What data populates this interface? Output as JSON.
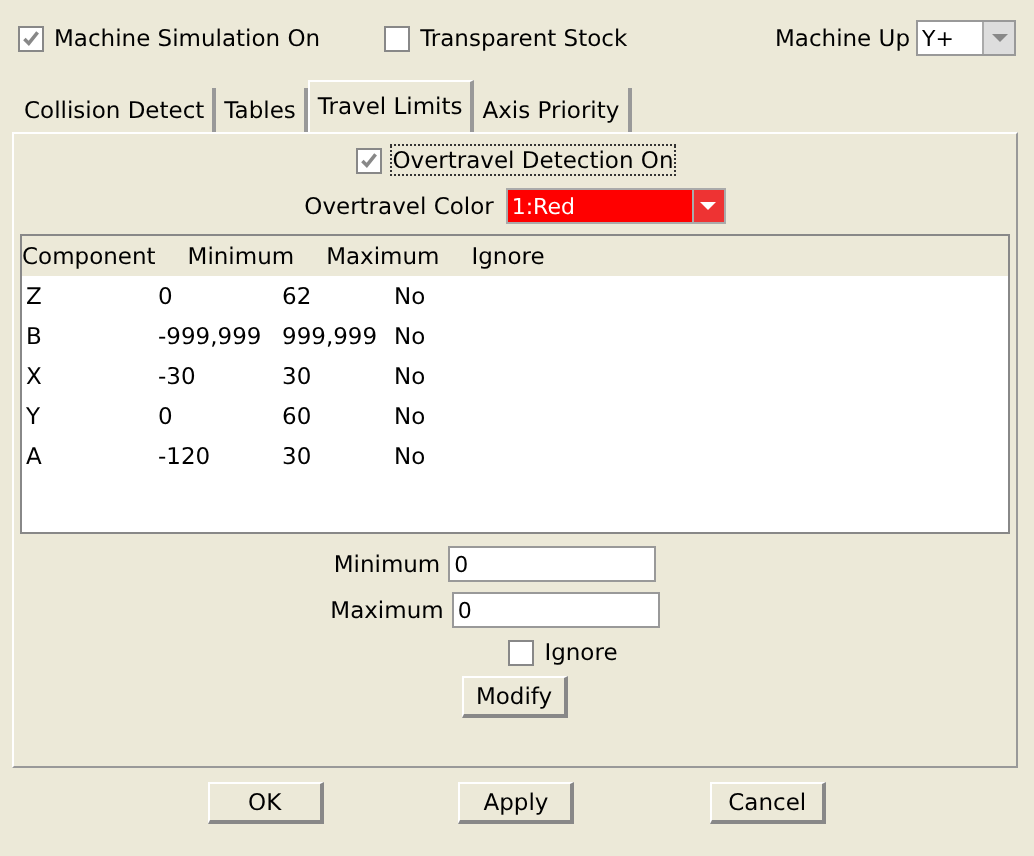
{
  "top_bar": {
    "machine_simulation": {
      "label": "Machine Simulation On",
      "checked": true
    },
    "transparent_stock": {
      "label": "Transparent Stock",
      "checked": false
    },
    "machine_up": {
      "label": "Machine Up",
      "value": "Y+"
    }
  },
  "tabs": [
    {
      "label": "Collision Detect",
      "selected": false
    },
    {
      "label": "Tables",
      "selected": false
    },
    {
      "label": "Travel Limits",
      "selected": true
    },
    {
      "label": "Axis Priority",
      "selected": false
    }
  ],
  "overtravel_detection": {
    "label": "Overtravel Detection On",
    "checked": true
  },
  "overtravel_color": {
    "label": "Overtravel Color",
    "value": "1:Red",
    "color": "#ff0000"
  },
  "table": {
    "columns": [
      "Component",
      "Minimum",
      "Maximum",
      "Ignore"
    ],
    "rows": [
      [
        "Z",
        "0",
        "62",
        "No"
      ],
      [
        "B",
        "-999,999",
        "999,999",
        "No"
      ],
      [
        "X",
        "-30",
        "30",
        "No"
      ],
      [
        "Y",
        "0",
        "60",
        "No"
      ],
      [
        "A",
        "-120",
        "30",
        "No"
      ]
    ]
  },
  "minimum": {
    "label": "Minimum",
    "value": "0"
  },
  "maximum": {
    "label": "Maximum",
    "value": "0"
  },
  "ignore": {
    "label": "Ignore",
    "checked": false
  },
  "modify_button": "Modify",
  "buttons": [
    "OK",
    "Apply",
    "Cancel"
  ]
}
